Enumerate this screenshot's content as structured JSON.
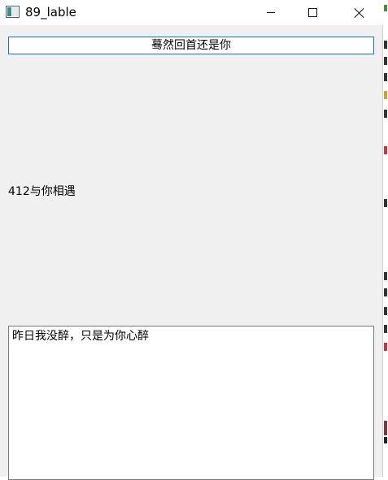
{
  "window": {
    "title": "89_lable"
  },
  "labels": {
    "heading": "蓦然回首还是你",
    "middle": "412与你相遇",
    "text_area": "昨日我没醉，只是为你心醉"
  },
  "icons": {
    "app": "app-window-icon",
    "minimize": "minimize-icon",
    "maximize": "maximize-icon",
    "close": "close-icon"
  },
  "colors": {
    "window_bg": "#f0f0f0",
    "titlebar_bg": "#ffffff",
    "heading_border": "#1a73c9",
    "textarea_border": "#7a7a7a"
  }
}
